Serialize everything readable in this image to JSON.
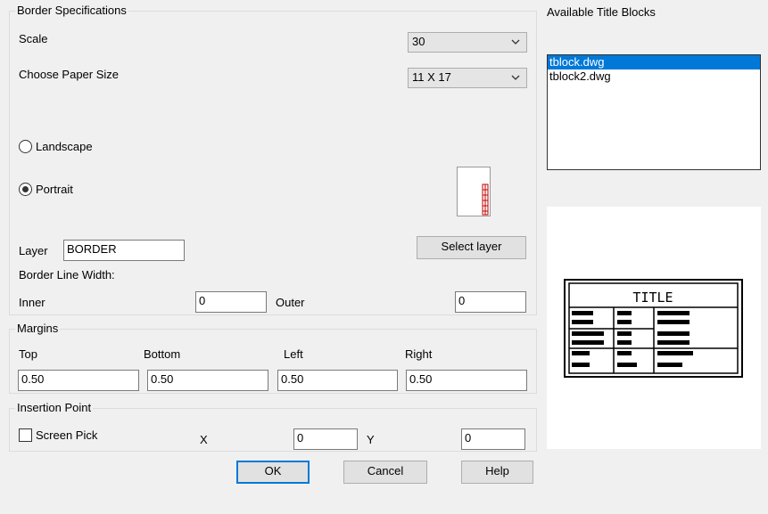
{
  "border_specs": {
    "title": "Border Specifications",
    "scale_label": "Scale",
    "scale_value": "30",
    "paper_label": "Choose Paper Size",
    "paper_value": "11 X 17",
    "landscape_label": "Landscape",
    "portrait_label": "Portrait",
    "orientation_selected": "portrait",
    "layer_label": "Layer",
    "layer_value": "BORDER",
    "select_layer_label": "Select layer",
    "line_width_label": "Border Line Width:",
    "inner_label": "Inner",
    "inner_value": "0",
    "outer_label": "Outer",
    "outer_value": "0"
  },
  "margins": {
    "title": "Margins",
    "top_label": "Top",
    "top_value": "0.50",
    "bottom_label": "Bottom",
    "bottom_value": "0.50",
    "left_label": "Left",
    "left_value": "0.50",
    "right_label": "Right",
    "right_value": "0.50"
  },
  "insertion": {
    "title": "Insertion Point",
    "screen_pick_label": "Screen Pick",
    "x_label": "X",
    "x_value": "0",
    "y_label": "Y",
    "y_value": "0"
  },
  "title_blocks": {
    "title": "Available Title Blocks",
    "items": [
      "tblock.dwg",
      "tblock2.dwg"
    ],
    "selected_index": 0,
    "preview_title": "TITLE"
  },
  "buttons": {
    "ok": "OK",
    "cancel": "Cancel",
    "help": "Help"
  },
  "colors": {
    "accent": "#0078d7",
    "portrait_icon": "#c00000"
  },
  "icons": {
    "combo_arrow": "chevron-down-icon",
    "orientation_preview": "portrait-paper-icon"
  }
}
